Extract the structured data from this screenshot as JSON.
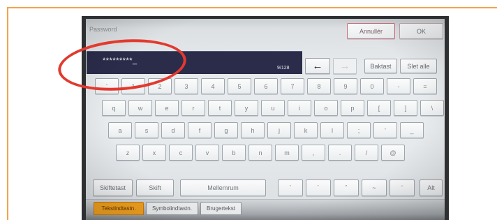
{
  "screen": {
    "title": "Password",
    "cancel_label": "Annullér",
    "ok_label": "OK"
  },
  "input": {
    "value": "*********_",
    "counter": "9/128"
  },
  "controls": {
    "cursor_left_icon": "arrow-left-icon",
    "cursor_left_glyph": "←",
    "cursor_right_icon": "arrow-right-icon",
    "cursor_right_glyph": "→",
    "cursor_right_enabled": false,
    "backspace_label": "Baktast",
    "clear_all_label": "Slet alle"
  },
  "keyboard": {
    "row1": [
      "`",
      "1",
      "2",
      "3",
      "4",
      "5",
      "6",
      "7",
      "8",
      "9",
      "0",
      "-",
      "="
    ],
    "row2": [
      "q",
      "w",
      "e",
      "r",
      "t",
      "y",
      "u",
      "i",
      "o",
      "p",
      "[",
      "]",
      "\\"
    ],
    "row3": [
      "a",
      "s",
      "d",
      "f",
      "g",
      "h",
      "j",
      "k",
      "l",
      ";",
      "'",
      "_"
    ],
    "row4": [
      "z",
      "x",
      "c",
      "v",
      "b",
      "n",
      "m",
      ",",
      ".",
      "/",
      "@"
    ]
  },
  "bottom_row": {
    "shift_lock_label": "Skiftetast",
    "shift_label": "Skift",
    "space_label": "Mellemrum",
    "accent_keys": [
      "`",
      "´",
      "ˆ",
      "~",
      "¨"
    ],
    "alt_label": "Alt"
  },
  "tabs": [
    {
      "label": "Tekstindtastn.",
      "active": true
    },
    {
      "label": "Symbolindtastn.",
      "active": false
    },
    {
      "label": "Brugertekst",
      "active": false
    }
  ],
  "colors": {
    "frame": "#f2a34c",
    "input_field": "#2a2c4a",
    "active_tab": "#f4a21f",
    "highlight_ellipse": "#e3392e",
    "cancel_border": "#c96b7a"
  }
}
